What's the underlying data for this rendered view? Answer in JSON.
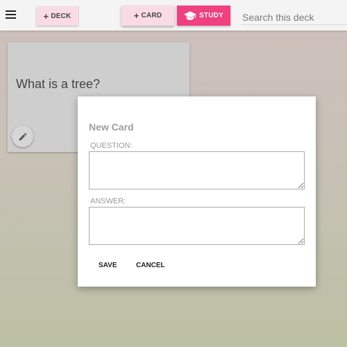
{
  "header": {
    "menu_icon": "hamburger-menu-icon",
    "deck_button": {
      "icon": "plus",
      "label": "DECK"
    },
    "card_button": {
      "icon": "plus",
      "label": "CARD"
    },
    "study_button": {
      "icon": "graduation-cap-icon",
      "label": "STUDY"
    },
    "search": {
      "placeholder": "Search this deck",
      "value": ""
    }
  },
  "deck": {
    "cards": [
      {
        "question": "What is a tree?",
        "edit_icon": "pencil-icon"
      }
    ]
  },
  "dialog": {
    "title": "New Card",
    "question_label": "QUESTION:",
    "question_value": "",
    "answer_label": "ANSWER:",
    "answer_value": "",
    "save_label": "SAVE",
    "cancel_label": "CANCEL"
  },
  "colors": {
    "accent_pink": "#f0407f",
    "button_pink": "#f9dbe5",
    "card_grey": "#cecece"
  }
}
